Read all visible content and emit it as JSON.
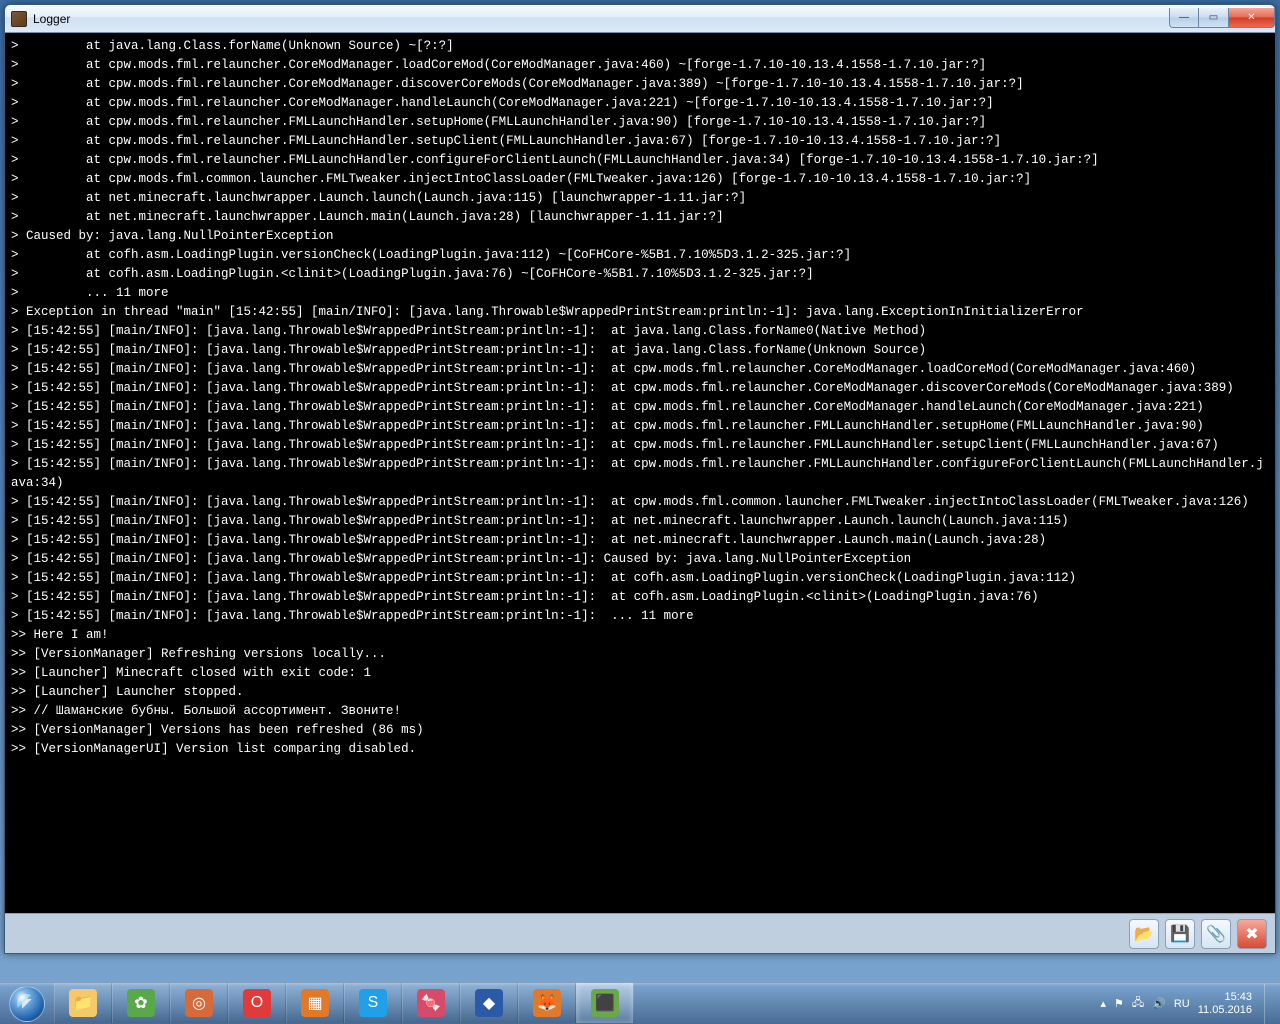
{
  "window": {
    "title": "Logger"
  },
  "log_lines": [
    ">         at java.lang.Class.forName(Unknown Source) ~[?:?]",
    ">         at cpw.mods.fml.relauncher.CoreModManager.loadCoreMod(CoreModManager.java:460) ~[forge-1.7.10-10.13.4.1558-1.7.10.jar:?]",
    ">         at cpw.mods.fml.relauncher.CoreModManager.discoverCoreMods(CoreModManager.java:389) ~[forge-1.7.10-10.13.4.1558-1.7.10.jar:?]",
    ">         at cpw.mods.fml.relauncher.CoreModManager.handleLaunch(CoreModManager.java:221) ~[forge-1.7.10-10.13.4.1558-1.7.10.jar:?]",
    ">         at cpw.mods.fml.relauncher.FMLLaunchHandler.setupHome(FMLLaunchHandler.java:90) [forge-1.7.10-10.13.4.1558-1.7.10.jar:?]",
    ">         at cpw.mods.fml.relauncher.FMLLaunchHandler.setupClient(FMLLaunchHandler.java:67) [forge-1.7.10-10.13.4.1558-1.7.10.jar:?]",
    ">         at cpw.mods.fml.relauncher.FMLLaunchHandler.configureForClientLaunch(FMLLaunchHandler.java:34) [forge-1.7.10-10.13.4.1558-1.7.10.jar:?]",
    ">         at cpw.mods.fml.common.launcher.FMLTweaker.injectIntoClassLoader(FMLTweaker.java:126) [forge-1.7.10-10.13.4.1558-1.7.10.jar:?]",
    ">         at net.minecraft.launchwrapper.Launch.launch(Launch.java:115) [launchwrapper-1.11.jar:?]",
    ">         at net.minecraft.launchwrapper.Launch.main(Launch.java:28) [launchwrapper-1.11.jar:?]",
    "> Caused by: java.lang.NullPointerException",
    ">         at cofh.asm.LoadingPlugin.versionCheck(LoadingPlugin.java:112) ~[CoFHCore-%5B1.7.10%5D3.1.2-325.jar:?]",
    ">         at cofh.asm.LoadingPlugin.<clinit>(LoadingPlugin.java:76) ~[CoFHCore-%5B1.7.10%5D3.1.2-325.jar:?]",
    ">         ... 11 more",
    "> Exception in thread \"main\" [15:42:55] [main/INFO]: [java.lang.Throwable$WrappedPrintStream:println:-1]: java.lang.ExceptionInInitializerError",
    "> [15:42:55] [main/INFO]: [java.lang.Throwable$WrappedPrintStream:println:-1]:  at java.lang.Class.forName0(Native Method)",
    "> [15:42:55] [main/INFO]: [java.lang.Throwable$WrappedPrintStream:println:-1]:  at java.lang.Class.forName(Unknown Source)",
    "> [15:42:55] [main/INFO]: [java.lang.Throwable$WrappedPrintStream:println:-1]:  at cpw.mods.fml.relauncher.CoreModManager.loadCoreMod(CoreModManager.java:460)",
    "> [15:42:55] [main/INFO]: [java.lang.Throwable$WrappedPrintStream:println:-1]:  at cpw.mods.fml.relauncher.CoreModManager.discoverCoreMods(CoreModManager.java:389)",
    "> [15:42:55] [main/INFO]: [java.lang.Throwable$WrappedPrintStream:println:-1]:  at cpw.mods.fml.relauncher.CoreModManager.handleLaunch(CoreModManager.java:221)",
    "> [15:42:55] [main/INFO]: [java.lang.Throwable$WrappedPrintStream:println:-1]:  at cpw.mods.fml.relauncher.FMLLaunchHandler.setupHome(FMLLaunchHandler.java:90)",
    "> [15:42:55] [main/INFO]: [java.lang.Throwable$WrappedPrintStream:println:-1]:  at cpw.mods.fml.relauncher.FMLLaunchHandler.setupClient(FMLLaunchHandler.java:67)",
    "> [15:42:55] [main/INFO]: [java.lang.Throwable$WrappedPrintStream:println:-1]:  at cpw.mods.fml.relauncher.FMLLaunchHandler.configureForClientLaunch(FMLLaunchHandler.java:34)",
    "> [15:42:55] [main/INFO]: [java.lang.Throwable$WrappedPrintStream:println:-1]:  at cpw.mods.fml.common.launcher.FMLTweaker.injectIntoClassLoader(FMLTweaker.java:126)",
    "> [15:42:55] [main/INFO]: [java.lang.Throwable$WrappedPrintStream:println:-1]:  at net.minecraft.launchwrapper.Launch.launch(Launch.java:115)",
    "> [15:42:55] [main/INFO]: [java.lang.Throwable$WrappedPrintStream:println:-1]:  at net.minecraft.launchwrapper.Launch.main(Launch.java:28)",
    "> [15:42:55] [main/INFO]: [java.lang.Throwable$WrappedPrintStream:println:-1]: Caused by: java.lang.NullPointerException",
    "> [15:42:55] [main/INFO]: [java.lang.Throwable$WrappedPrintStream:println:-1]:  at cofh.asm.LoadingPlugin.versionCheck(LoadingPlugin.java:112)",
    "> [15:42:55] [main/INFO]: [java.lang.Throwable$WrappedPrintStream:println:-1]:  at cofh.asm.LoadingPlugin.<clinit>(LoadingPlugin.java:76)",
    "> [15:42:55] [main/INFO]: [java.lang.Throwable$WrappedPrintStream:println:-1]:  ... 11 more",
    ">> Here I am!",
    ">> [VersionManager] Refreshing versions locally...",
    ">> [Launcher] Minecraft closed with exit code: 1",
    ">> [Launcher] Launcher stopped.",
    ">> // Шаманские бубны. Большой ассортимент. Звоните!",
    ">> [VersionManager] Versions has been refreshed (86 ms)",
    ">> [VersionManagerUI] Version list comparing disabled."
  ],
  "toolbar_buttons": {
    "folder": "folder-icon",
    "save": "save-icon",
    "attach": "attach-icon",
    "close": "close-icon"
  },
  "taskbar": {
    "apps": [
      {
        "name": "explorer",
        "color": "#f5c869",
        "glyph": "📁"
      },
      {
        "name": "green-app",
        "color": "#5ba84a",
        "glyph": "✿"
      },
      {
        "name": "burn-app",
        "color": "#d66a3a",
        "glyph": "◎"
      },
      {
        "name": "opera",
        "color": "#e03a3a",
        "glyph": "O"
      },
      {
        "name": "orange-app",
        "color": "#e07a2a",
        "glyph": "▦"
      },
      {
        "name": "skype",
        "color": "#1fa0e8",
        "glyph": "S"
      },
      {
        "name": "candy-app",
        "color": "#d64a6a",
        "glyph": "🍬"
      },
      {
        "name": "blue-app",
        "color": "#2a5aa8",
        "glyph": "◆"
      },
      {
        "name": "firefox",
        "color": "#e07a2a",
        "glyph": "🦊"
      },
      {
        "name": "minecraft",
        "color": "#6aa84a",
        "glyph": "⬛"
      }
    ],
    "tray": {
      "lang": "RU",
      "time": "15:43",
      "date": "11.05.2016"
    }
  }
}
